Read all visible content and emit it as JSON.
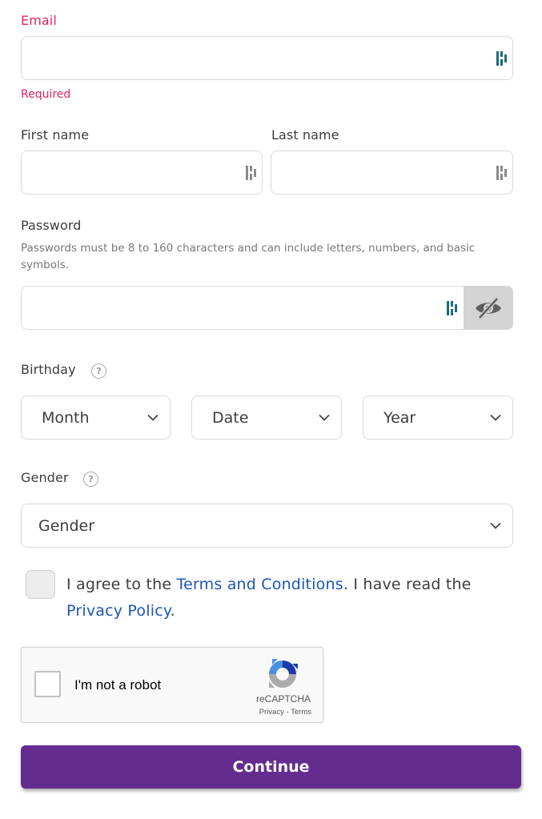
{
  "email": {
    "label": "Email",
    "value": "",
    "placeholder": "",
    "error": "Required"
  },
  "first_name": {
    "label": "First name",
    "value": "",
    "placeholder": ""
  },
  "last_name": {
    "label": "Last name",
    "value": "",
    "placeholder": ""
  },
  "password": {
    "label": "Password",
    "help": "Passwords must be 8 to 160 characters and can include letters, numbers, and basic symbols.",
    "value": "",
    "placeholder": "",
    "toggle_icon": "eye-slash-icon"
  },
  "birthday": {
    "label": "Birthday",
    "help_icon": "question-circle-icon",
    "month": "Month",
    "date": "Date",
    "year": "Year"
  },
  "gender": {
    "label": "Gender",
    "help_icon": "question-circle-icon",
    "selected": "Gender"
  },
  "agreement": {
    "prefix": "I agree to the ",
    "terms_link": "Terms and Conditions",
    "middle": ". I have read the ",
    "privacy_link": "Privacy Policy",
    "suffix": ".",
    "checked": false
  },
  "recaptcha": {
    "label": "I'm not a robot",
    "brand": "reCAPTCHA",
    "privacy": "Privacy",
    "separator": " - ",
    "terms": "Terms"
  },
  "continue_label": "Continue",
  "colors": {
    "error": "#e0245e",
    "link": "#1c55b5",
    "primary": "#652c90",
    "autofill_icon_active": "#1d6d7a",
    "autofill_icon_inactive": "#8a8a8a"
  }
}
